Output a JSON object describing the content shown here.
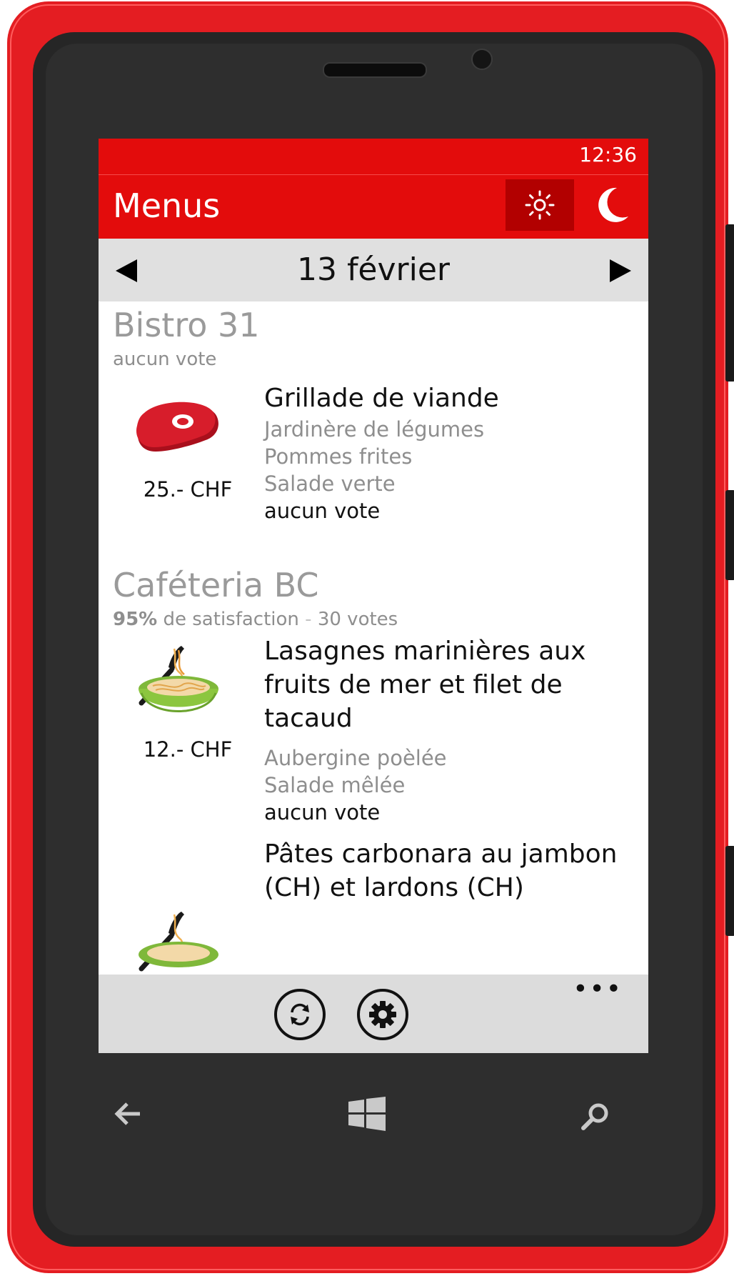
{
  "status_bar": {
    "time": "12:36"
  },
  "app_bar": {
    "title": "Menus",
    "sun_icon": "sun-icon",
    "moon_icon": "moon-icon"
  },
  "date_nav": {
    "date": "13 février",
    "prev_icon": "triangle-left-icon",
    "next_icon": "triangle-right-icon"
  },
  "restaurants": [
    {
      "name": "Bistro 31",
      "rating": "aucun vote",
      "dishes": [
        {
          "icon": "steak-icon",
          "price": "25.- CHF",
          "title": "Grillade de viande",
          "sides": [
            "Jardinère de légumes",
            "Pommes frites",
            "Salade verte"
          ],
          "votes": "aucun vote"
        }
      ]
    },
    {
      "name": "Caféteria BC",
      "satisfaction": "95%",
      "satisfaction_label": "de satisfaction",
      "separator": "-",
      "votes_count": "30 votes",
      "dishes": [
        {
          "icon": "pasta-bowl-icon",
          "price": "12.- CHF",
          "title_lines": [
            "Lasagnes marinières aux",
            "fruits de mer et filet de",
            "tacaud"
          ],
          "sides": [
            "Aubergine poèlée",
            "Salade mêlée"
          ],
          "votes": "aucun vote"
        },
        {
          "icon": "pasta-bowl-icon",
          "title": "Pâtes carbonara au jambon",
          "title_cut": "(CH) et lardons (CH)"
        }
      ]
    }
  ],
  "bottom_bar": {
    "refresh_icon": "refresh-icon",
    "settings_icon": "gear-icon",
    "more": "•••"
  },
  "hardware_keys": {
    "back": "back-arrow-icon",
    "home": "windows-logo-icon",
    "search": "search-icon"
  },
  "colors": {
    "accent": "#e30c0c",
    "accent_dark": "#b20000",
    "phone_body": "#e41d22"
  }
}
